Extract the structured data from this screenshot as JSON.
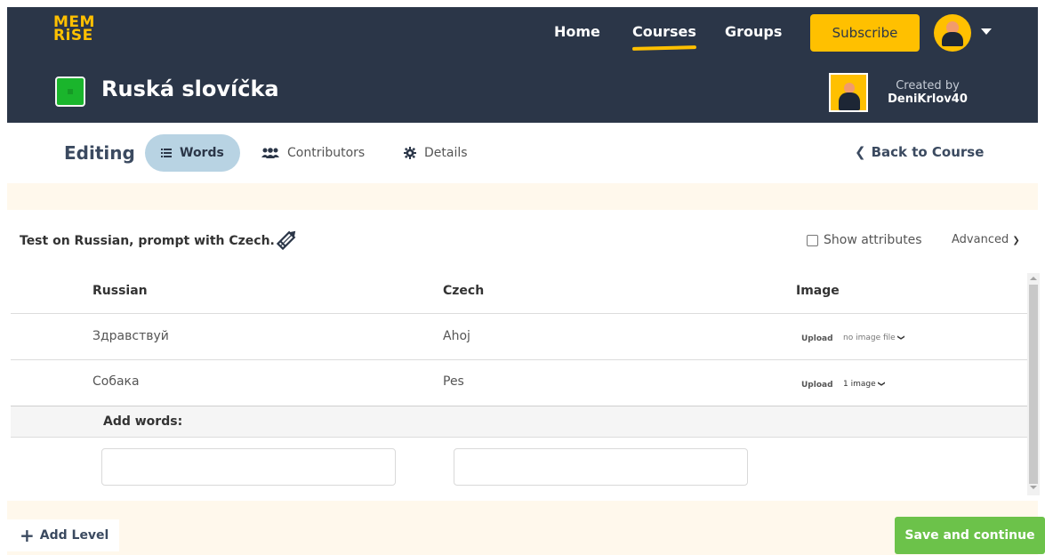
{
  "header": {
    "logo_line1": "MEM",
    "logo_line2": "RiSE",
    "nav": {
      "home": "Home",
      "courses": "Courses",
      "groups": "Groups"
    },
    "subscribe_label": "Subscribe",
    "course_title": "Ruská slovíčka",
    "created_by_label": "Created by",
    "creator_name": "DeniKrlov40"
  },
  "edit_nav": {
    "editing_label": "Editing",
    "tabs": {
      "words": "Words",
      "contributors": "Contributors",
      "details": "Details"
    },
    "back_label": "Back to Course"
  },
  "level": {
    "description": "Test on Russian, prompt with Czech.",
    "show_attributes_label": "Show attributes",
    "advanced_label": "Advanced",
    "columns": {
      "russian": "Russian",
      "czech": "Czech",
      "image": "Image"
    },
    "rows": [
      {
        "russian": "Здравствуй",
        "czech": "Ahoj",
        "upload": "Upload",
        "image_status": "no image file"
      },
      {
        "russian": "Собака",
        "czech": "Pes",
        "upload": "Upload",
        "image_status": "1 image"
      }
    ],
    "add_words_label": "Add words:"
  },
  "footer": {
    "add_level_label": "Add Level",
    "save_label": "Save and continue"
  },
  "colors": {
    "header_bg": "#2b3648",
    "accent_yellow": "#ffc000",
    "active_tab": "#b8d3e3",
    "save_green": "#6cc24a"
  }
}
